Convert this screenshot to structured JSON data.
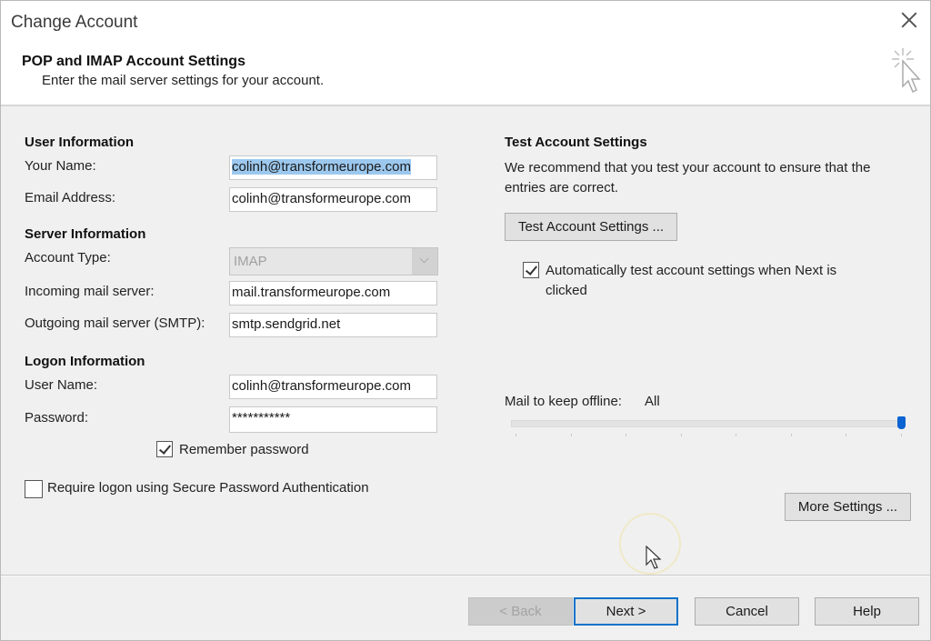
{
  "window": {
    "title": "Change Account",
    "close_icon": "close-x-icon"
  },
  "header": {
    "title": "POP and IMAP Account Settings",
    "subtitle": "Enter the mail server settings for your account.",
    "icon": "cursor-click-icon"
  },
  "user_information": {
    "title": "User Information",
    "your_name": {
      "label": "Your Name:",
      "value": "colinh@transformeurope.com",
      "selected": true
    },
    "email_address": {
      "label": "Email Address:",
      "value": "colinh@transformeurope.com"
    }
  },
  "server_information": {
    "title": "Server Information",
    "account_type": {
      "label": "Account Type:",
      "value": "IMAP",
      "disabled": true
    },
    "incoming": {
      "label": "Incoming mail server:",
      "value": "mail.transformeurope.com"
    },
    "outgoing": {
      "label": "Outgoing mail server (SMTP):",
      "value": "smtp.sendgrid.net"
    }
  },
  "logon_information": {
    "title": "Logon Information",
    "user_name": {
      "label": "User Name:",
      "value": "colinh@transformeurope.com"
    },
    "password": {
      "label": "Password:",
      "value": "***********"
    },
    "remember_password": {
      "label": "Remember password",
      "checked": true
    },
    "require_spa": {
      "label": "Require logon using Secure Password Authentication",
      "checked": false
    }
  },
  "test_settings": {
    "title": "Test Account Settings",
    "description": "We recommend that you test your account to ensure that the entries are correct.",
    "button_label": "Test Account Settings ...",
    "auto_test": {
      "label": "Automatically test account settings when Next is clicked",
      "checked": true
    }
  },
  "offline": {
    "label": "Mail to keep offline:",
    "value": "All",
    "slider_position_fraction": 1.0,
    "tick_count": 8
  },
  "more_settings_label": "More Settings ...",
  "footer": {
    "back_label": "< Back",
    "next_label": "Next >",
    "cancel_label": "Cancel",
    "help_label": "Help"
  },
  "colors": {
    "selection": "#9cc8ee",
    "default_button_border": "#0a72c9",
    "slider_thumb": "#0b64d1",
    "background": "#f0f0f0"
  }
}
